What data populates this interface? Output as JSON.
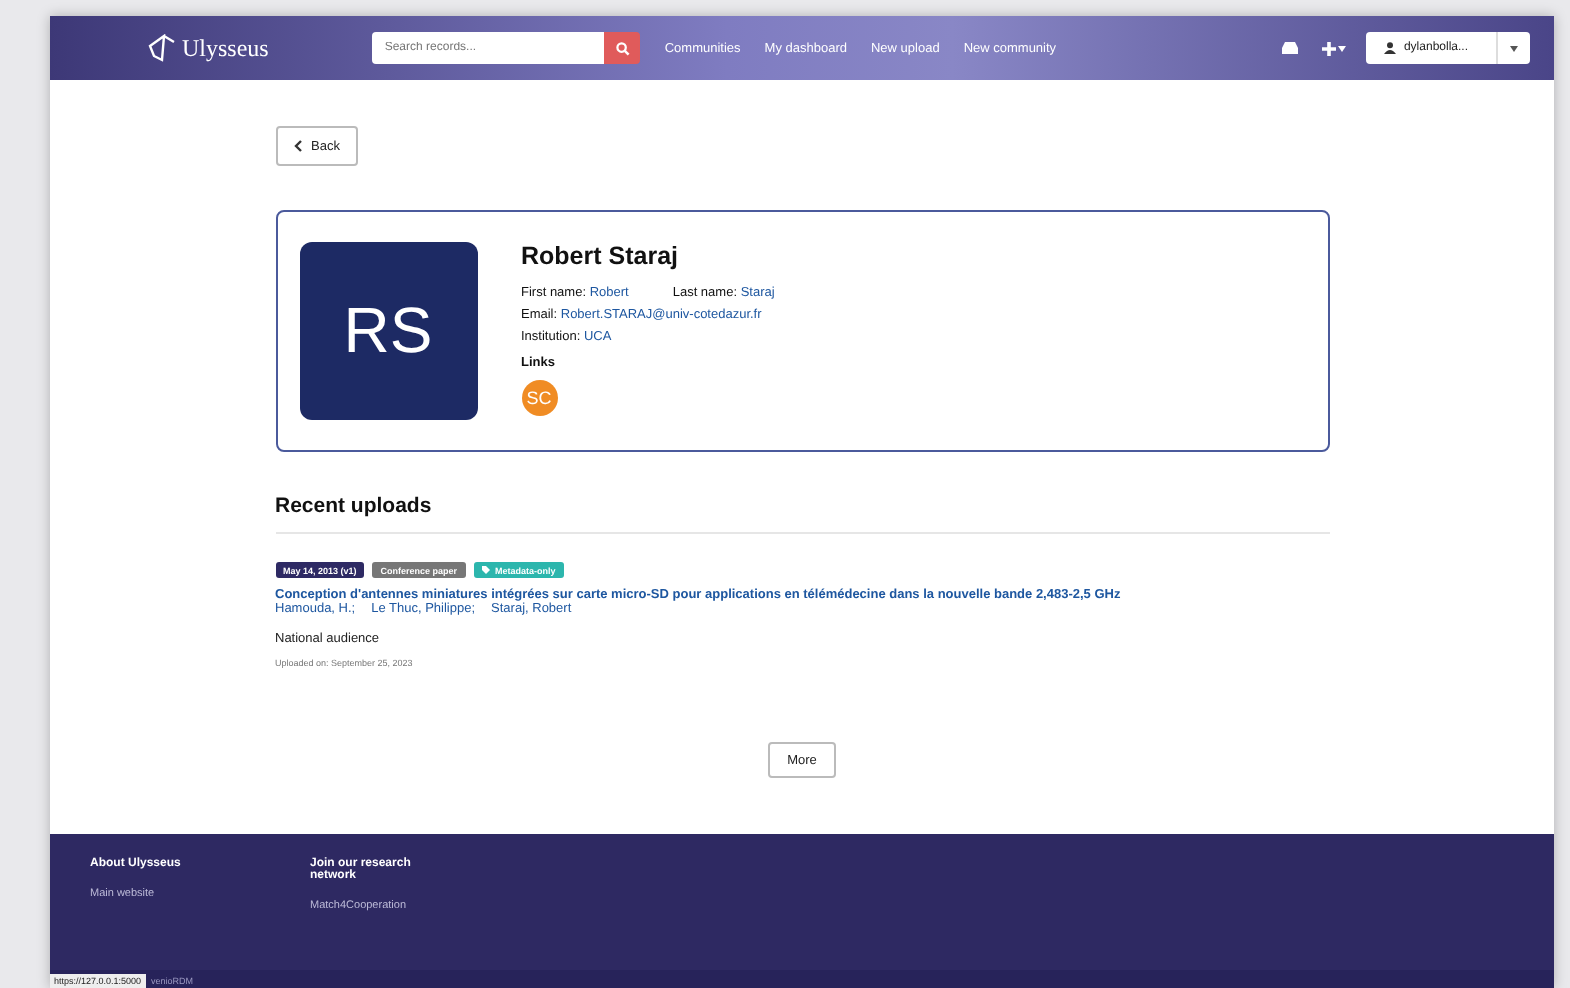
{
  "header": {
    "logo": "Ulysseus",
    "search": {
      "placeholder": "Search records..."
    },
    "nav": [
      "Communities",
      "My dashboard",
      "New upload",
      "New community"
    ],
    "user": "dylanbolla..."
  },
  "back": "Back",
  "profile": {
    "initials": "RS",
    "name": "Robert Staraj",
    "fields": [
      {
        "label": "First name:",
        "value": "Robert"
      },
      {
        "label": "Last name:",
        "value": "Staraj"
      },
      {
        "label": "Email:",
        "value": "Robert.STARAJ@univ-cotedazur.fr"
      },
      {
        "label": "Institution:",
        "value": "UCA"
      }
    ],
    "links_title": "Links",
    "links": [
      "SC"
    ]
  },
  "recent": {
    "title": "Recent uploads",
    "items": [
      {
        "badges": [
          {
            "kind": "date",
            "text": "May 14, 2013 (v1)"
          },
          {
            "kind": "type",
            "text": "Conference paper"
          },
          {
            "kind": "access",
            "text": "Metadata-only"
          }
        ],
        "title": "Conception d'antennes miniatures intégrées sur carte micro-SD pour applications en télémédecine dans la nouvelle bande 2,483-2,5 GHz",
        "authors": [
          "Hamouda, H.;",
          "Le Thuc, Philippe;",
          "Staraj, Robert"
        ],
        "description": "National audience",
        "uploaded": "Uploaded on: September 25, 2023"
      }
    ]
  },
  "more": "More",
  "footer": {
    "columns": [
      {
        "title": "About Ulysseus",
        "links": [
          "Main website"
        ]
      },
      {
        "title": "Join our research network",
        "links": [
          "Match4Cooperation"
        ]
      }
    ],
    "status_url": "https://127.0.0.1:5000",
    "powered": "venioRDM"
  }
}
